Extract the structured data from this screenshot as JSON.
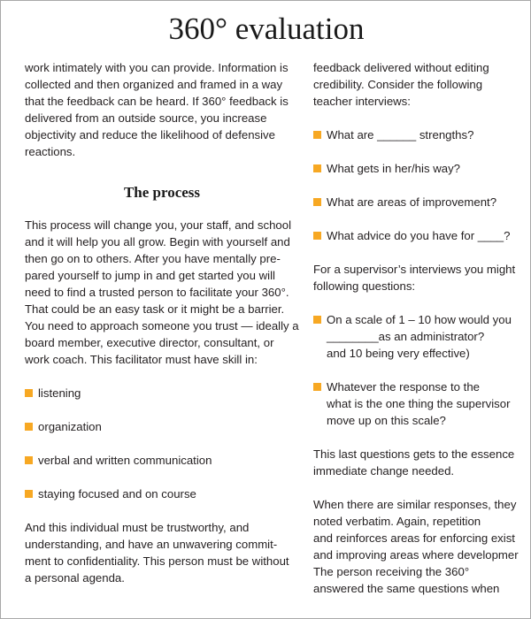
{
  "title": "360° evaluation",
  "left": {
    "intro_lines": [
      "work intimately with you can provide. Information is",
      "collected and then organized and framed in a way",
      "that the feedback can be heard. If 360° feedback is",
      "delivered from an outside source, you increase",
      "objectivity and reduce the likelihood of defensive",
      "reactions."
    ],
    "heading": "The process",
    "process_lines": [
      "This process will change you, your staff, and school",
      "and it will help you all grow. Begin with yourself and",
      "then go on to others. After you have mentally pre-",
      "pared yourself to jump in and get started you will",
      "need to find a trusted person to facilitate your 360°.",
      "That could be an easy task or it might be a barrier.",
      "You need to approach someone you trust — ideally a",
      "board member, executive director, consultant, or",
      "work coach. This facilitator must have skill in:"
    ],
    "skills": [
      "listening",
      "organization",
      "verbal and written communication",
      "staying focused and on course"
    ],
    "closing_lines": [
      "And this individual must be trustworthy, and",
      "understanding, and have an unwavering commit-",
      "ment to confidentiality. This person must be without",
      "a personal agenda."
    ]
  },
  "right": {
    "intro_lines": [
      "feedback delivered without editing",
      "credibility. Consider the following",
      "teacher interviews:"
    ],
    "teacher_questions": [
      "What are ______ strengths?",
      "What gets in her/his way?",
      "What are areas of improvement?",
      "What advice do you have for ____?"
    ],
    "supervisor_intro_lines": [
      "For a supervisor’s interviews you might",
      "following questions:"
    ],
    "supervisor_questions": [
      {
        "lines": [
          "On a scale of 1 – 10 how would you",
          "________as an administrator?",
          "and 10 being very effective)"
        ]
      },
      {
        "lines": [
          "Whatever the response to the",
          "what is the one thing the supervisor",
          "move up on this scale?"
        ]
      }
    ],
    "essence_lines": [
      "This last questions gets to the essence",
      "immediate change needed."
    ],
    "similar_lines": [
      "When there are similar responses, they",
      "noted verbatim. Again, repetition",
      "and reinforces areas for enforcing exist",
      "and improving areas where developmer",
      "The person receiving the 360°",
      "answered the same questions when"
    ]
  },
  "colors": {
    "bullet": "#f7a823",
    "text": "#231f20",
    "border": "#a8a8a8"
  }
}
